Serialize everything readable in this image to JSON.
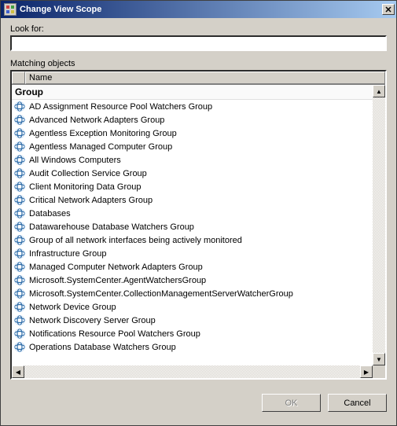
{
  "window": {
    "title": "Change View Scope"
  },
  "look_for": {
    "label": "Look for:",
    "value": ""
  },
  "matching": {
    "label": "Matching objects"
  },
  "columns": {
    "name": "Name"
  },
  "group_header": "Group",
  "items": [
    "AD Assignment Resource Pool Watchers Group",
    "Advanced Network Adapters Group",
    "Agentless Exception Monitoring Group",
    "Agentless Managed Computer Group",
    "All Windows Computers",
    "Audit Collection Service Group",
    "Client Monitoring Data Group",
    "Critical Network Adapters Group",
    "Databases",
    "Datawarehouse Database Watchers Group",
    "Group of all network interfaces being actively monitored",
    "Infrastructure Group",
    "Managed Computer Network Adapters Group",
    "Microsoft.SystemCenter.AgentWatchersGroup",
    "Microsoft.SystemCenter.CollectionManagementServerWatcherGroup",
    "Network Device Group",
    "Network Discovery Server Group",
    "Notifications Resource Pool Watchers Group",
    "Operations Database Watchers Group"
  ],
  "buttons": {
    "ok": "OK",
    "cancel": "Cancel"
  }
}
